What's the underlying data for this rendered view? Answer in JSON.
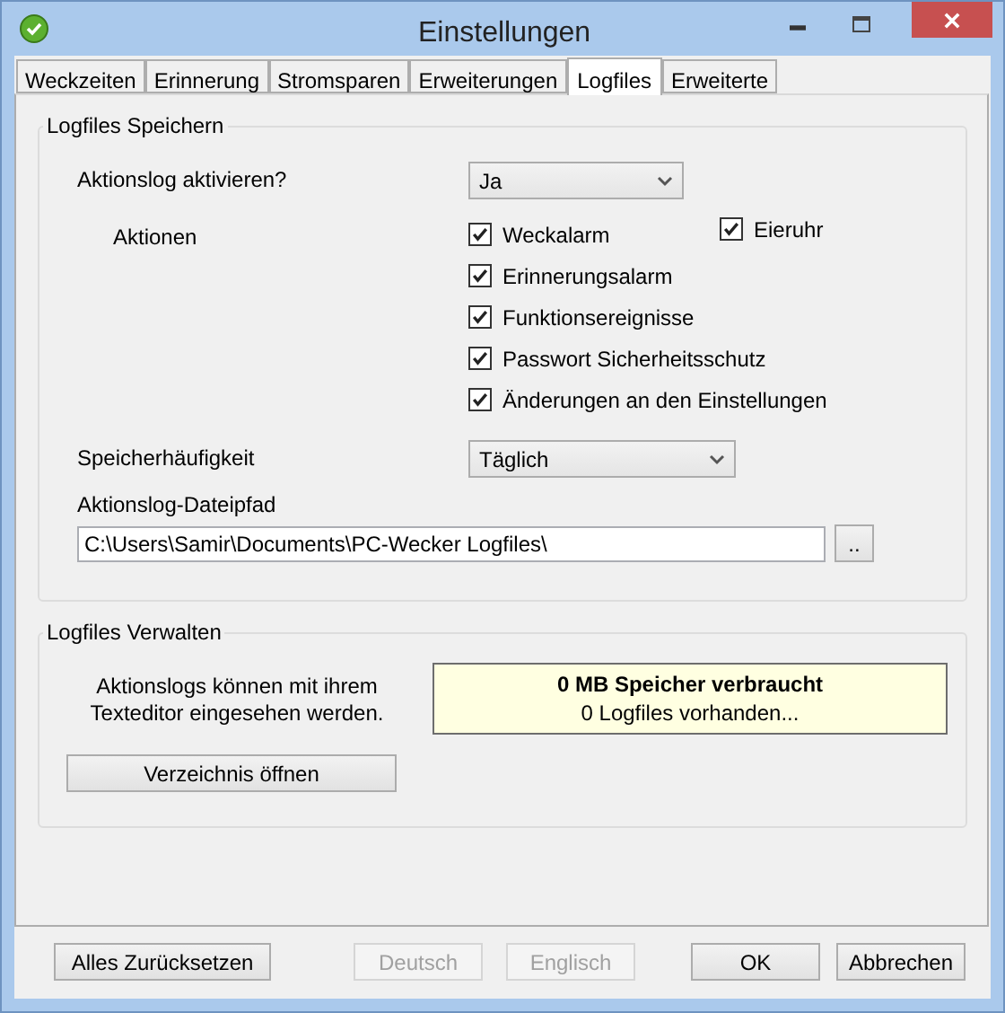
{
  "window": {
    "title": "Einstellungen"
  },
  "tabs": [
    {
      "label": "Weckzeiten",
      "selected": false
    },
    {
      "label": "Erinnerung",
      "selected": false
    },
    {
      "label": "Stromsparen",
      "selected": false
    },
    {
      "label": "Erweiterungen",
      "selected": false
    },
    {
      "label": "Logfiles",
      "selected": true
    },
    {
      "label": "Erweiterte",
      "selected": false
    }
  ],
  "save_group": {
    "title": "Logfiles Speichern",
    "activate": {
      "label": "Aktionslog aktivieren?",
      "value": "Ja"
    },
    "actions_label": "Aktionen",
    "actions": [
      {
        "label": "Weckalarm",
        "checked": true
      },
      {
        "label": "Erinnerungsalarm",
        "checked": true
      },
      {
        "label": "Funktionsereignisse",
        "checked": true
      },
      {
        "label": "Passwort Sicherheitsschutz",
        "checked": true
      },
      {
        "label": "Änderungen an den Einstellungen",
        "checked": true
      }
    ],
    "extra_actions": [
      {
        "label": "Eieruhr",
        "checked": true
      }
    ],
    "frequency": {
      "label": "Speicherhäufigkeit",
      "value": "Täglich"
    },
    "path": {
      "label": "Aktionslog-Dateipfad",
      "value": "C:\\Users\\Samir\\Documents\\PC-Wecker Logfiles\\",
      "browse": ".."
    }
  },
  "manage_group": {
    "title": "Logfiles Verwalten",
    "hint": "Aktionslogs können mit ihrem Texteditor eingesehen werden.",
    "usage": "0 MB Speicher verbraucht",
    "count": "0 Logfiles vorhanden...",
    "open_button": "Verzeichnis öffnen"
  },
  "buttons": [
    {
      "label": "Alles Zurücksetzen",
      "disabled": false
    },
    {
      "label": "Deutsch",
      "disabled": true
    },
    {
      "label": "Englisch",
      "disabled": true
    },
    {
      "label": "OK",
      "disabled": false
    },
    {
      "label": "Abbrechen",
      "disabled": false
    }
  ]
}
